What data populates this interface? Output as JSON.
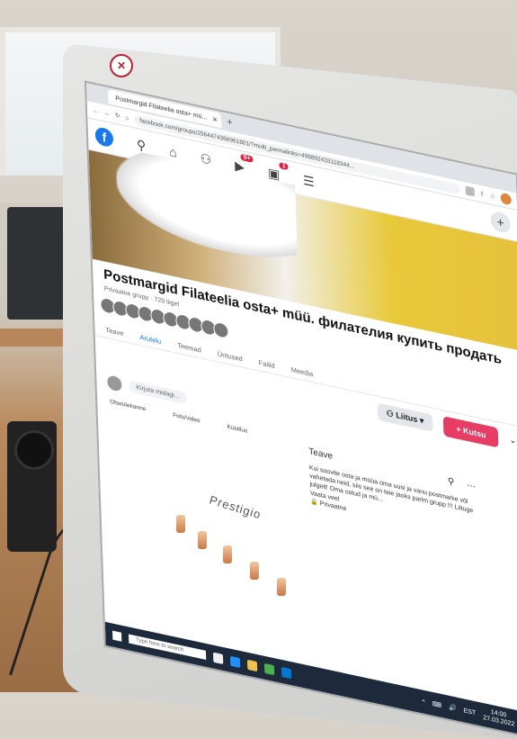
{
  "browser": {
    "tab_title": "Postmargid Filateelia osta+ mü...",
    "tab_close": "×",
    "new_tab": "+",
    "url": "facebook.com/groups/2564474366961801/?multi_permalinks=498892433118344..."
  },
  "facebook": {
    "logo": "f",
    "notifications_badge": "9+",
    "marketplace_badge": "1",
    "create_label": "+",
    "group": {
      "name": "Postmargid Filateelia osta+ müü. филателия купить продать",
      "meta": "Privaatne grupp · 729 liiget"
    },
    "tabs": [
      "Teave",
      "Arutelu",
      "Teemad",
      "Üritused",
      "Failid",
      "Meedia"
    ],
    "active_tab": "Arutelu",
    "join_button": "Liitus",
    "invite_button": "+ Kutsu",
    "composer_placeholder": "Kirjuta midagi...",
    "quick_actions": [
      "Otseülekanne",
      "Foto/video",
      "Küsitlus"
    ],
    "about": {
      "heading": "Teave",
      "text": "Kui soovite osta ja müüa oma uusi ja vanu postmarke või vahetada neid, siis see on teie jaoks parim grupp !!! Liituge julgelt! Oma ostud ja mü...",
      "see_more": "Vaata veel",
      "privacy_label": "Privaatne"
    }
  },
  "taskbar": {
    "search_placeholder": "Type here to search",
    "language": "EST",
    "time": "14:00",
    "date": "27.03.2022"
  },
  "monitor": {
    "brand": "Prestigio"
  },
  "colors": {
    "facebook_blue": "#1877f2",
    "invite_pink": "#e73c63",
    "taskbar": "#1c2a3c"
  }
}
